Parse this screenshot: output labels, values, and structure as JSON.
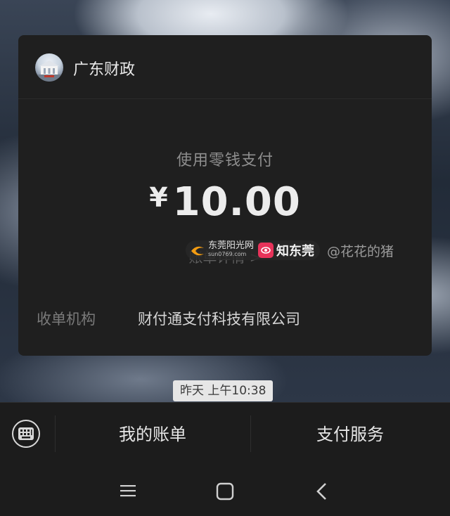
{
  "payment": {
    "merchant_name": "广东财政",
    "pay_method": "使用零钱支付",
    "currency_symbol": "¥",
    "amount": "10.00",
    "detail_link": "账单详情 >",
    "merchant_org_label": "收单机构",
    "merchant_org_value": "财付通支付科技有限公司"
  },
  "watermark": {
    "logo1_text": "东莞阳光网",
    "logo1_sub": "sun0769.com",
    "logo2_text": "知东莞",
    "handle": "@花花的猪"
  },
  "chat": {
    "timestamp": "昨天 上午10:38"
  },
  "menu": {
    "items": [
      "我的账单",
      "支付服务"
    ]
  },
  "icons": {
    "keyboard": "keyboard-icon",
    "nav_menu": "menu-icon",
    "nav_home": "home-icon",
    "nav_back": "back-icon"
  },
  "colors": {
    "card_bg": "#1f1f1f",
    "menu_bg": "#1c1c1c",
    "logo2_accent": "#e8335a"
  }
}
